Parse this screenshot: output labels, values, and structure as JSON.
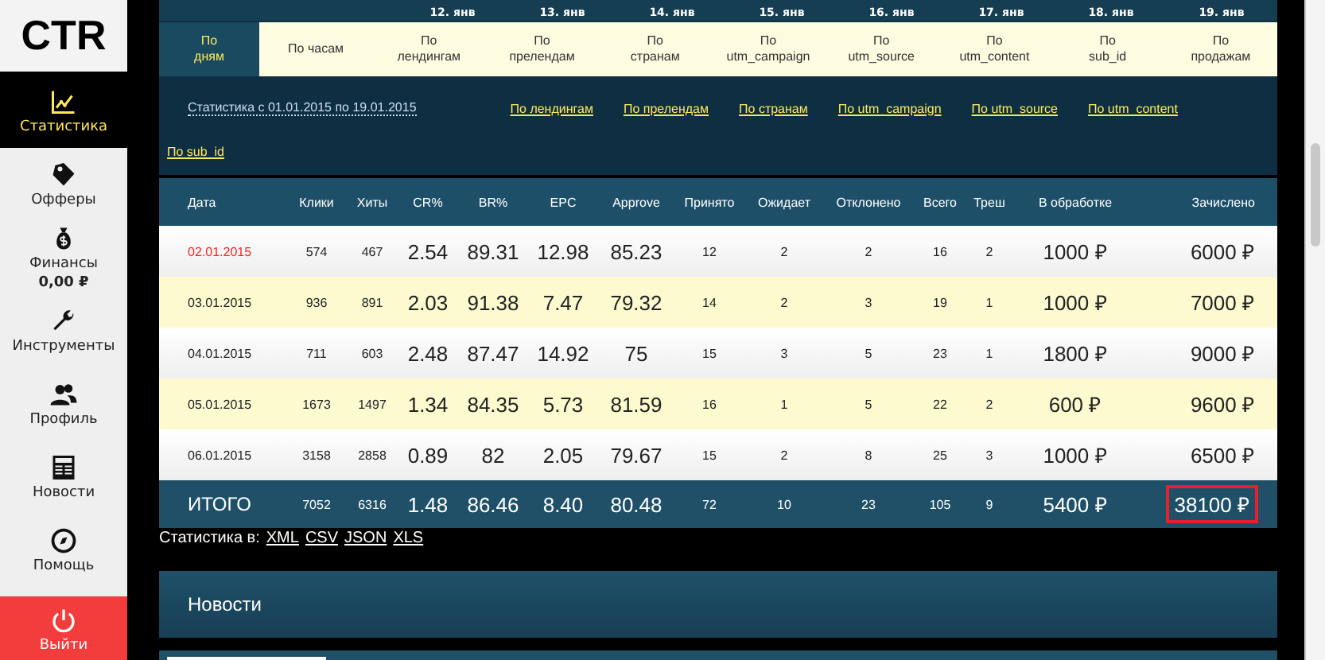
{
  "sidebar": {
    "logo": "CTR",
    "items": [
      {
        "kind": "chart",
        "label": "Статистика",
        "selected": true
      },
      {
        "kind": "tag",
        "label": "Офферы",
        "selected": false
      },
      {
        "kind": "money",
        "label": "Финансы",
        "sub": "0,00 ₽",
        "selected": false
      },
      {
        "kind": "wrench",
        "label": "Инструменты",
        "selected": false
      },
      {
        "kind": "people",
        "label": "Профиль",
        "selected": false
      },
      {
        "kind": "news",
        "label": "Новости",
        "selected": false
      },
      {
        "kind": "help",
        "label": "Помощь",
        "selected": false
      },
      {
        "kind": "power",
        "label": "Выйти",
        "selected": false
      }
    ]
  },
  "date_strip": [
    "12. янв",
    "13. янв",
    "14. янв",
    "15. янв",
    "16. янв",
    "17. янв",
    "18. янв",
    "19. янв"
  ],
  "tabs": [
    {
      "label": "По\nдням",
      "selected": true
    },
    {
      "label": "По часам",
      "selected": false
    },
    {
      "label": "По\nлендингам",
      "selected": false
    },
    {
      "label": "По\nпрелендам",
      "selected": false
    },
    {
      "label": "По\nстранам",
      "selected": false
    },
    {
      "label": "По\nutm_campaign",
      "selected": false
    },
    {
      "label": "По\nutm_source",
      "selected": false
    },
    {
      "label": "По\nutm_content",
      "selected": false
    },
    {
      "label": "По\nsub_id",
      "selected": false
    },
    {
      "label": "По\nпродажам",
      "selected": false
    }
  ],
  "filters": {
    "period": "Статистика с 01.01.2015 по 19.01.2015",
    "links": [
      "По лендингам",
      "По прелендам",
      "По странам",
      "По utm_campaign",
      "По utm_source",
      "По utm_content",
      "По sub_id"
    ]
  },
  "table": {
    "columns": [
      {
        "label": "Дата",
        "kind": "date"
      },
      {
        "label": "Клики",
        "kind": "count"
      },
      {
        "label": "Хиты",
        "kind": "count"
      },
      {
        "label": "CR%",
        "kind": "metric"
      },
      {
        "label": "BR%",
        "kind": "metric"
      },
      {
        "label": "EPC",
        "kind": "metric"
      },
      {
        "label": "Approve",
        "kind": "metric"
      },
      {
        "label": "Принято",
        "kind": "count"
      },
      {
        "label": "Ожидает",
        "kind": "count"
      },
      {
        "label": "Отклонено",
        "kind": "count"
      },
      {
        "label": "Всего",
        "kind": "count"
      },
      {
        "label": "Треш",
        "kind": "count"
      },
      {
        "label": "В обработке",
        "kind": "money"
      },
      {
        "label": "Зачислено",
        "kind": "money"
      }
    ],
    "rows": [
      {
        "highlighted": true,
        "cells": [
          "02.01.2015",
          "574",
          "467",
          "2.54",
          "89.31",
          "12.98",
          "85.23",
          "12",
          "2",
          "2",
          "16",
          "2",
          "1000 ₽",
          "6000 ₽"
        ]
      },
      {
        "highlighted": false,
        "cells": [
          "03.01.2015",
          "936",
          "891",
          "2.03",
          "91.38",
          "7.47",
          "79.32",
          "14",
          "2",
          "3",
          "19",
          "1",
          "1000 ₽",
          "7000 ₽"
        ]
      },
      {
        "highlighted": false,
        "cells": [
          "04.01.2015",
          "711",
          "603",
          "2.48",
          "87.47",
          "14.92",
          "75",
          "15",
          "3",
          "5",
          "23",
          "1",
          "1800 ₽",
          "9000 ₽"
        ]
      },
      {
        "highlighted": false,
        "cells": [
          "05.01.2015",
          "1673",
          "1497",
          "1.34",
          "84.35",
          "5.73",
          "81.59",
          "16",
          "1",
          "5",
          "22",
          "2",
          "600 ₽",
          "9600 ₽"
        ]
      },
      {
        "highlighted": false,
        "cells": [
          "06.01.2015",
          "3158",
          "2858",
          "0.89",
          "82",
          "2.05",
          "79.67",
          "15",
          "2",
          "8",
          "25",
          "3",
          "1000 ₽",
          "6500 ₽"
        ]
      }
    ],
    "total": {
      "cells": [
        "ИТОГО",
        "7052",
        "6316",
        "1.48",
        "86.46",
        "8.40",
        "80.48",
        "72",
        "10",
        "23",
        "105",
        "9",
        "5400 ₽",
        "38100 ₽"
      ],
      "marked": true
    }
  },
  "export": {
    "label": "Статистика в:",
    "formats": [
      "XML",
      "CSV",
      "JSON",
      "XLS"
    ]
  },
  "news": {
    "title": "Новости"
  }
}
